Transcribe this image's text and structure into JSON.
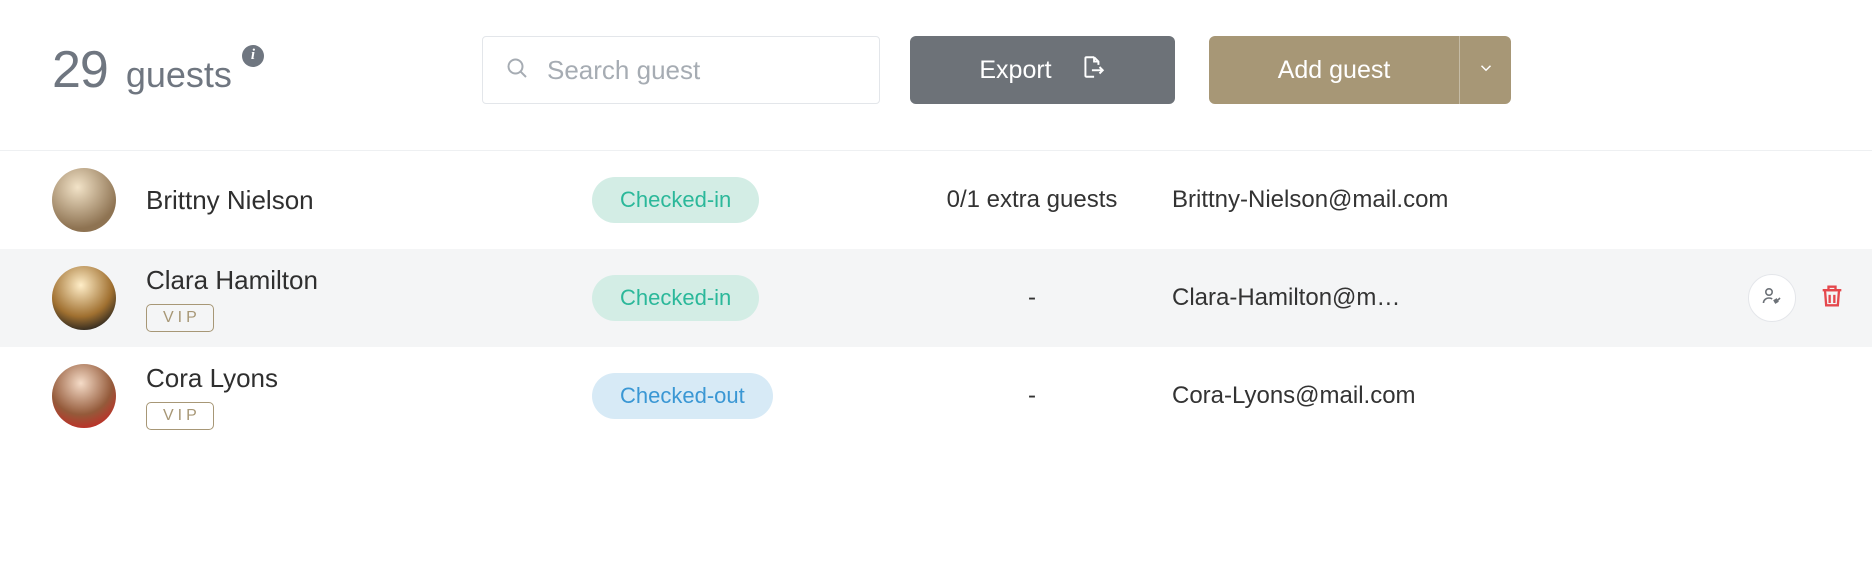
{
  "header": {
    "count": "29",
    "count_label": "guests",
    "info_tooltip": "i",
    "search_placeholder": "Search guest",
    "export_label": "Export",
    "add_label": "Add guest"
  },
  "guests": [
    {
      "name": "Brittny Nielson",
      "vip": false,
      "status": "Checked-in",
      "status_kind": "in",
      "extra": "0/1 extra guests",
      "email": "Brittny-Nielson@mail.com",
      "hovered": false,
      "avatar_class": "av1"
    },
    {
      "name": "Clara Hamilton",
      "vip": true,
      "status": "Checked-in",
      "status_kind": "in",
      "extra": "-",
      "email": "Clara-Hamilton@m…",
      "hovered": true,
      "avatar_class": "av2"
    },
    {
      "name": "Cora Lyons",
      "vip": true,
      "status": "Checked-out",
      "status_kind": "out",
      "extra": "-",
      "email": "Cora-Lyons@mail.com",
      "hovered": false,
      "avatar_class": "av3"
    }
  ],
  "labels": {
    "vip": "VIP"
  }
}
